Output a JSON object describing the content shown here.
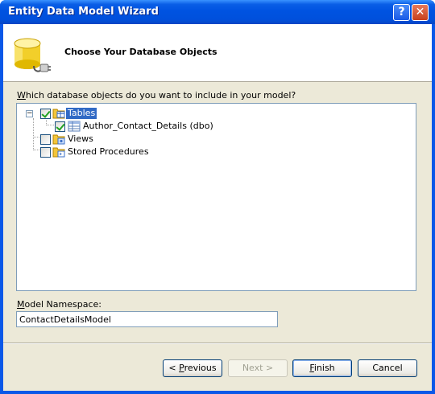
{
  "window": {
    "title": "Entity Data Model Wizard",
    "help_label": "?",
    "close_label": "✕"
  },
  "header": {
    "title": "Choose Your Database Objects",
    "icon": "database-plug-icon"
  },
  "question": {
    "accel": "W",
    "rest": "hich database objects do you want to include in your model?"
  },
  "tree": {
    "items": [
      {
        "label": "Tables",
        "checked": true,
        "expanded": true,
        "selected": true,
        "icon": "tables-icon",
        "children": [
          {
            "label": "Author_Contact_Details (dbo)",
            "checked": true,
            "icon": "table-icon"
          }
        ]
      },
      {
        "label": "Views",
        "checked": false,
        "icon": "views-icon"
      },
      {
        "label": "Stored Procedures",
        "checked": false,
        "icon": "stored-procedures-icon"
      }
    ]
  },
  "namespace": {
    "label_accel": "M",
    "label_rest": "odel Namespace:",
    "value": "ContactDetailsModel"
  },
  "buttons": {
    "previous": {
      "prefix": "< ",
      "accel": "P",
      "rest": "revious"
    },
    "next": {
      "label": "Next >",
      "disabled": true
    },
    "finish": {
      "accel": "F",
      "rest": "inish"
    },
    "cancel": {
      "label": "Cancel"
    }
  },
  "colors": {
    "titlebar": "#0053e1",
    "selection": "#316ac5",
    "dialog_bg": "#ece9d8"
  }
}
